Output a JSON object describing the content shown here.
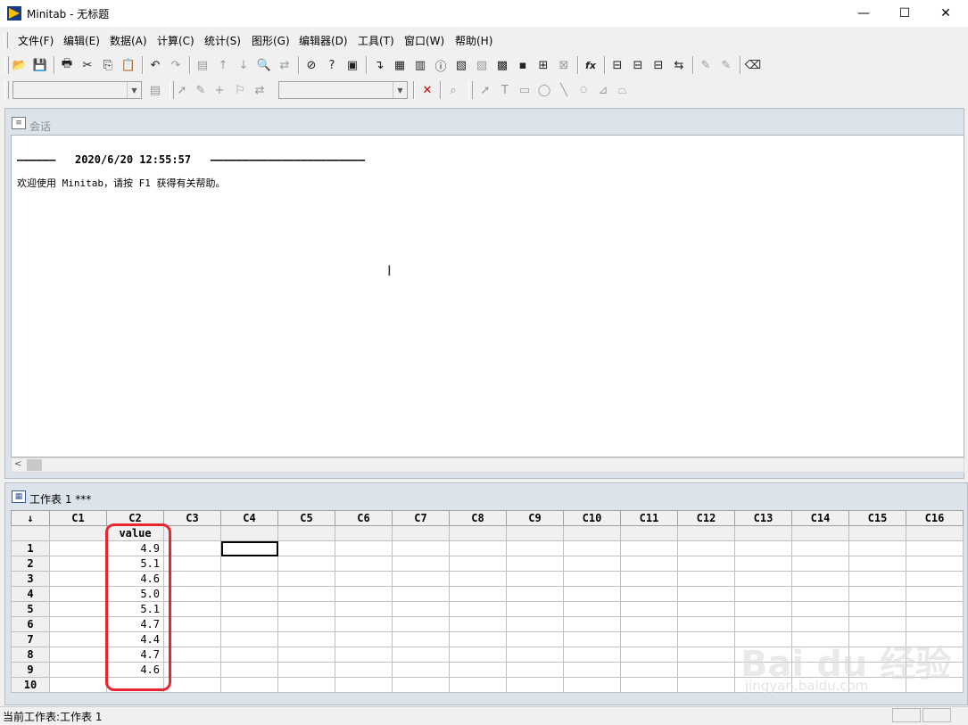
{
  "window": {
    "title": "Minitab - 无标题",
    "minimize": "—",
    "maximize": "☐",
    "close": "✕"
  },
  "menu": [
    "文件(F)",
    "编辑(E)",
    "数据(A)",
    "计算(C)",
    "统计(S)",
    "图形(G)",
    "编辑器(D)",
    "工具(T)",
    "窗口(W)",
    "帮助(H)"
  ],
  "toolbar": {
    "icons": [
      "open-icon",
      "save-icon",
      "print-icon",
      "cut-icon",
      "copy-icon",
      "paste-icon",
      "undo-icon",
      "redo-icon",
      "edit-last-dialog-icon",
      "arrow-up-icon",
      "arrow-down-icon",
      "find-icon",
      "replace-icon",
      "cancel-icon",
      "help-icon",
      "stat-guide-icon",
      "new-column-icon",
      "session-window-icon",
      "data-window-icon",
      "info-icon",
      "history-icon",
      "graph-folder-icon",
      "report-pad-icon",
      "related-documents-icon",
      "project-manager-icon",
      "close-all-graphs-icon",
      "fx-icon",
      "insert-cells-icon",
      "insert-rows-icon",
      "insert-columns-icon",
      "move-columns-icon",
      "brush-icon",
      "set-id-icon",
      "eraser-icon"
    ],
    "glyphs": [
      "📂",
      "💾",
      "🖶",
      "✂",
      "⎘",
      "📋",
      "↶",
      "↷",
      "▤",
      "↑",
      "↓",
      "🔍",
      "⇄",
      "⊘",
      "?",
      "▣",
      "↴",
      "▦",
      "▥",
      "ⓘ",
      "▧",
      "▨",
      "▩",
      "▪",
      "⊞",
      "⊠",
      "fx",
      "⊟",
      "⊟",
      "⊟",
      "⇆",
      "✎",
      "✎",
      "⌫"
    ]
  },
  "session": {
    "title": "会话",
    "header_line": "——————   2020/6/20 12:55:57   ————————————————————————",
    "welcome": "欢迎使用 Minitab，请按 F1 获得有关帮助。"
  },
  "worksheet": {
    "title": "工作表 1 ***",
    "corner": "↓",
    "columns": [
      "C1",
      "C2",
      "C3",
      "C4",
      "C5",
      "C6",
      "C7",
      "C8",
      "C9",
      "C10",
      "C11",
      "C12",
      "C13",
      "C14",
      "C15",
      "C16"
    ],
    "column_names": [
      "",
      "value",
      "",
      "",
      "",
      "",
      "",
      "",
      "",
      "",
      "",
      "",
      "",
      "",
      "",
      ""
    ],
    "rows": [
      "1",
      "2",
      "3",
      "4",
      "5",
      "6",
      "7",
      "8",
      "9",
      "10"
    ],
    "c2_values": [
      "4.9",
      "5.1",
      "4.6",
      "5.0",
      "5.1",
      "4.7",
      "4.4",
      "4.7",
      "4.6",
      ""
    ]
  },
  "status": {
    "text": "当前工作表:工作表 1"
  },
  "watermark": {
    "main": "Bai du 经验",
    "sub": "jingyan.baidu.com"
  }
}
